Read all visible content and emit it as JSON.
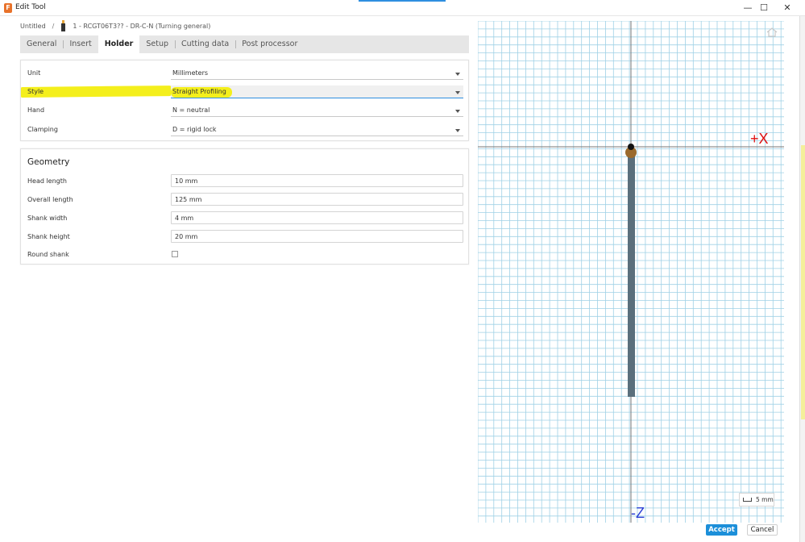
{
  "window": {
    "title": "Edit Tool",
    "minimize_glyph": "—",
    "maximize_glyph": "☐",
    "close_glyph": "✕"
  },
  "breadcrumb": {
    "root": "Untitled",
    "separator": "/",
    "tool": "1 - RCGT06T3?? - DR-C-N (Turning general)"
  },
  "tabs": [
    {
      "label": "General"
    },
    {
      "label": "Insert"
    },
    {
      "label": "Holder",
      "active": true
    },
    {
      "label": "Setup"
    },
    {
      "label": "Cutting data"
    },
    {
      "label": "Post processor"
    }
  ],
  "holder": {
    "unit": {
      "label": "Unit",
      "value": "Millimeters"
    },
    "style": {
      "label": "Style",
      "value": "Straight Profiling"
    },
    "hand": {
      "label": "Hand",
      "value": "N = neutral"
    },
    "clamping": {
      "label": "Clamping",
      "value": "D = rigid lock"
    }
  },
  "geometry": {
    "title": "Geometry",
    "head_length": {
      "label": "Head length",
      "value": "10 mm"
    },
    "overall_length": {
      "label": "Overall length",
      "value": "125 mm"
    },
    "shank_width": {
      "label": "Shank width",
      "value": "4 mm"
    },
    "shank_height": {
      "label": "Shank height",
      "value": "20 mm"
    },
    "round_shank": {
      "label": "Round shank",
      "checked": false
    }
  },
  "viewport": {
    "x_axis_label": "+X",
    "z_axis_label": "-Z",
    "scale_label": "5 mm",
    "colors": {
      "grid": "#9fd1e6",
      "axis": "#777777",
      "x_label": "#e01010",
      "z_label": "#2b3fd6",
      "shank": "#5a6f7c",
      "insert": "#9b6a2c",
      "tip": "#111111"
    }
  },
  "footer": {
    "accept": "Accept",
    "cancel": "Cancel"
  }
}
